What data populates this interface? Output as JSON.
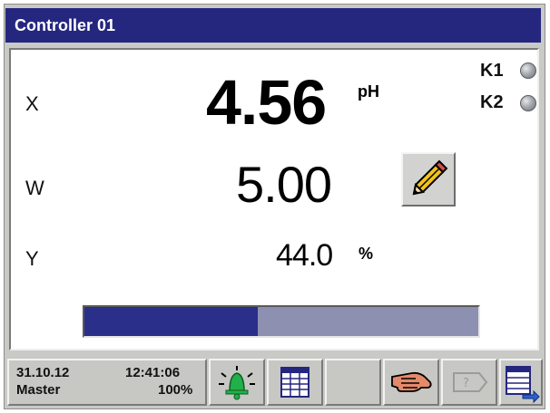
{
  "window": {
    "title": "Controller 01"
  },
  "process": {
    "x": {
      "label": "X",
      "value": "4.56",
      "unit": "pH"
    },
    "w": {
      "label": "W",
      "value": "5.00"
    },
    "y": {
      "label": "Y",
      "value": "44.0",
      "unit": "%",
      "level_fraction": 0.44
    }
  },
  "indicators": [
    {
      "label": "K1",
      "state": "off"
    },
    {
      "label": "K2",
      "state": "off"
    }
  ],
  "status": {
    "date": "31.10.12",
    "time": "12:41:06",
    "user": "Master",
    "percent": "100%"
  },
  "icons": {
    "edit": "pencil-icon",
    "alarm": "bell-icon",
    "table": "table-icon",
    "manual": "hand-icon",
    "help": "help-icon",
    "export": "table-export-icon"
  },
  "colors": {
    "title_bar": "#25277f",
    "bar_fill": "#2a2f8a",
    "bar_track": "#8d90b0",
    "alarm_icon": "#22b04a"
  }
}
